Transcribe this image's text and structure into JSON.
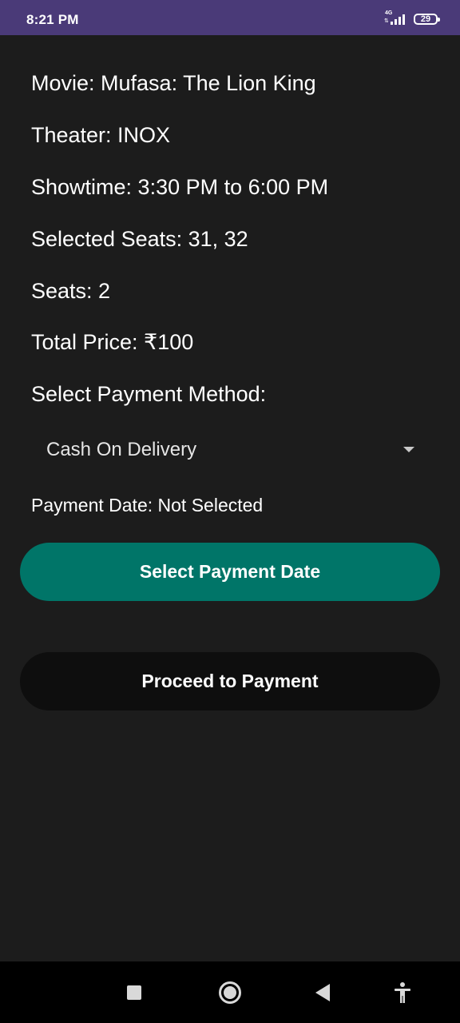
{
  "status_bar": {
    "time": "8:21 PM",
    "network": "4G",
    "battery": "29"
  },
  "booking": {
    "movie": "Movie: Mufasa: The Lion King",
    "theater": "Theater: INOX",
    "showtime": "Showtime: 3:30 PM to 6:00 PM",
    "selected_seats": "Selected Seats: 31, 32",
    "seat_count": "Seats: 2",
    "total_price": "Total Price: ₹100"
  },
  "payment": {
    "method_label": "Select Payment Method:",
    "method_selected": "Cash On Delivery",
    "date_text": "Payment Date: Not Selected",
    "select_date_button": "Select Payment Date",
    "proceed_button": "Proceed to Payment"
  },
  "nav_bar": {
    "icons": [
      "recents-square-icon",
      "home-circle-icon",
      "back-triangle-icon",
      "accessibility-icon"
    ]
  },
  "colors": {
    "status_bar": "#4a3a78",
    "background": "#1c1c1c",
    "primary_button": "#007568",
    "secondary_button": "#0e0e0e"
  }
}
